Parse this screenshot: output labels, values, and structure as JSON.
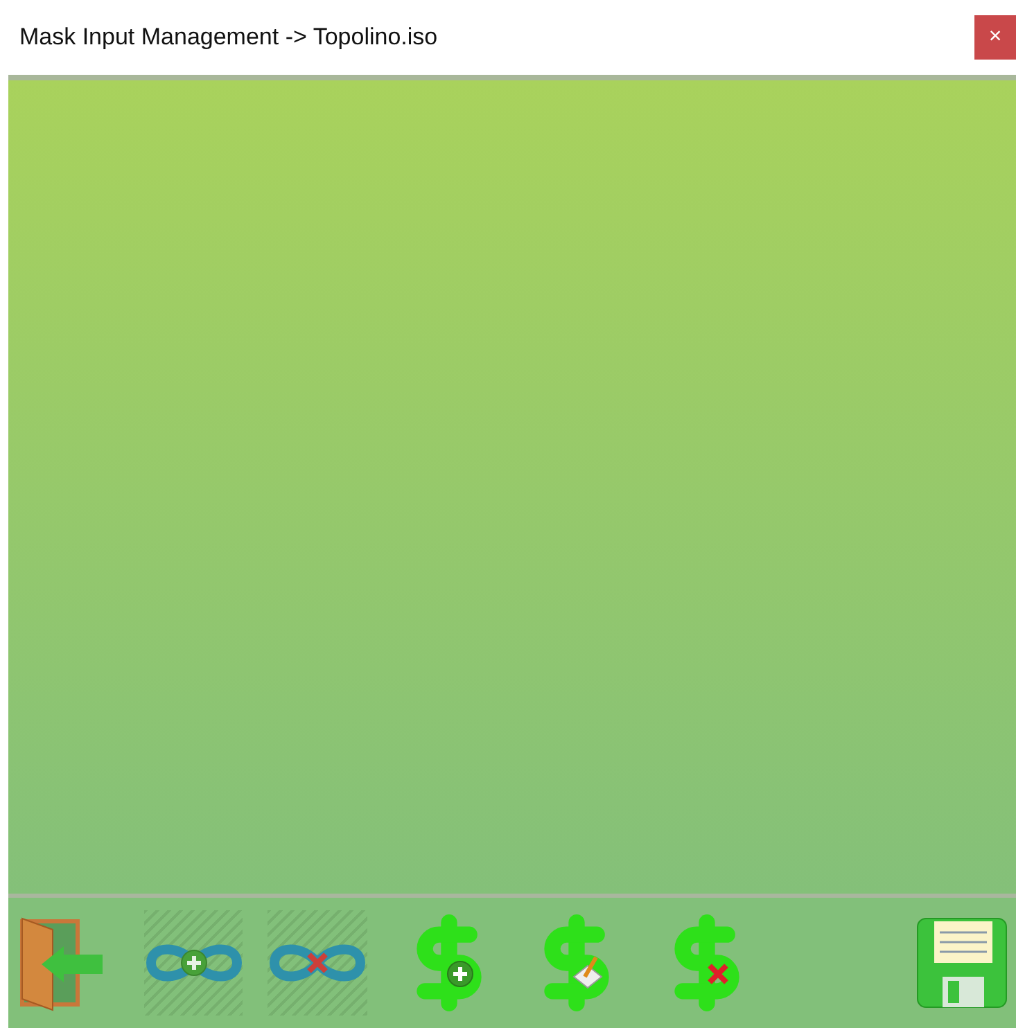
{
  "window": {
    "title": "Mask Input Management -> Topolino.iso",
    "close": "×"
  },
  "toolbar": [
    {
      "kind": "exit",
      "disabled": false
    },
    {
      "kind": "link-add",
      "disabled": true
    },
    {
      "kind": "link-remove",
      "disabled": true
    },
    {
      "kind": "money-add",
      "disabled": false
    },
    {
      "kind": "money-edit",
      "disabled": false
    },
    {
      "kind": "money-remove",
      "disabled": false
    },
    {
      "kind": "save",
      "disabled": false
    }
  ]
}
